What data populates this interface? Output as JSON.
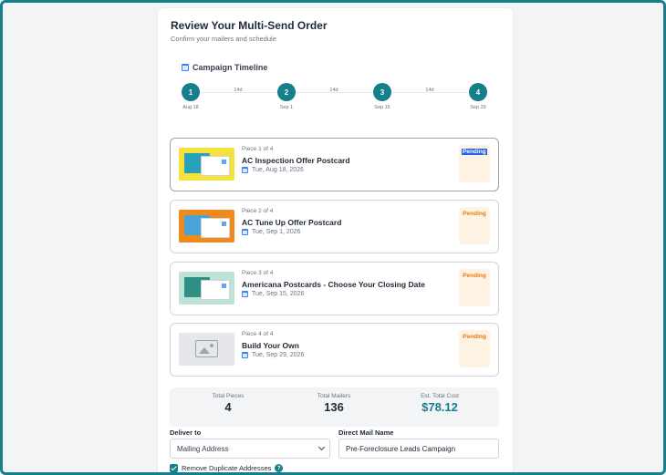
{
  "header": {
    "title": "Review Your Multi-Send Order",
    "subtitle": "Confirm your mailers and schedule"
  },
  "timeline": {
    "title": "Campaign Timeline",
    "steps": [
      {
        "number": "1",
        "date": "Aug 18"
      },
      {
        "number": "2",
        "date": "Sep 1"
      },
      {
        "number": "3",
        "date": "Sep 15"
      },
      {
        "number": "4",
        "date": "Sep 29"
      }
    ],
    "gaps": [
      "14d",
      "14d",
      "14d"
    ]
  },
  "pieces": [
    {
      "index": "Piece 1 of 4",
      "name": "AC Inspection Offer Postcard",
      "date": "Tue, Aug 18, 2026",
      "status": "Pending"
    },
    {
      "index": "Piece 2 of 4",
      "name": "AC Tune Up Offer Postcard",
      "date": "Tue, Sep 1, 2026",
      "status": "Pending"
    },
    {
      "index": "Piece 3 of 4",
      "name": "Americana Postcards - Choose Your Closing Date",
      "date": "Tue, Sep 15, 2026",
      "status": "Pending"
    },
    {
      "index": "Piece 4 of 4",
      "name": "Build Your Own",
      "date": "Tue, Sep 29, 2026",
      "status": "Pending"
    }
  ],
  "totals": {
    "pieces_label": "Total Pieces",
    "pieces_value": "4",
    "mailers_label": "Total Mailers",
    "mailers_value": "136",
    "cost_label": "Est. Total Cost",
    "cost_value": "$78.12"
  },
  "form": {
    "deliver_label": "Deliver to",
    "deliver_value": "Mailing Address",
    "name_label": "Direct Mail Name",
    "name_value": "Pre-Foreclosure Leads Campaign",
    "dedupe_label": "Remove Duplicate Addresses",
    "dedupe_checked": true
  },
  "colors": {
    "accent": "#157f8c",
    "pending_bg": "#fef3e2",
    "pending_text": "#e07b16"
  }
}
